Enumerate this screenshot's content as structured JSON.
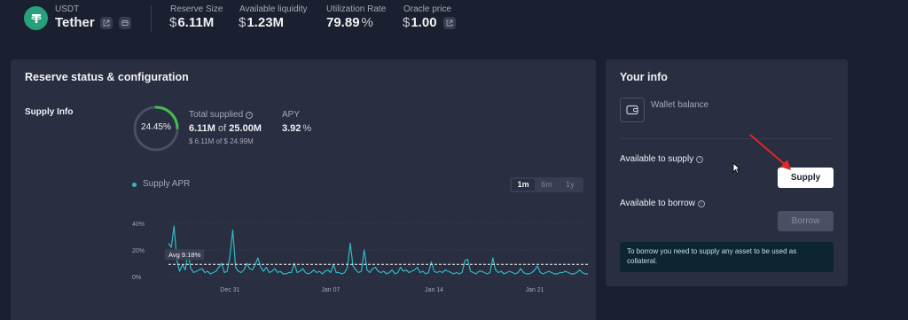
{
  "header": {
    "symbol": "USDT",
    "name": "Tether",
    "logo_icon": "tether-logo-icon",
    "logo_color": "#26a17b",
    "stats": [
      {
        "label": "Reserve Size",
        "currency": "$",
        "value": "6.11M"
      },
      {
        "label": "Available liquidity",
        "currency": "$",
        "value": "1.23M"
      },
      {
        "label": "Utilization Rate",
        "value": "79.89",
        "suffix": "%"
      },
      {
        "label": "Oracle price",
        "currency": "$",
        "value": "1.00"
      }
    ]
  },
  "reserve": {
    "title": "Reserve status & configuration",
    "supply_info_label": "Supply Info",
    "ring_percent_text": "24.45%",
    "ring_fraction": 0.2445,
    "ring_color": "#46bc4b",
    "total_supplied_label": "Total supplied",
    "total_supplied_value": "6.11M",
    "total_supplied_of": "of",
    "total_supplied_cap": "25.00M",
    "total_supplied_usd": "$ 6.11M of $ 24.99M",
    "apy_label": "APY",
    "apy_value": "3.92",
    "apy_suffix": "%",
    "legend": "Supply APR",
    "ranges": [
      {
        "label": "1m",
        "active": true
      },
      {
        "label": "6m",
        "active": false
      },
      {
        "label": "1y",
        "active": false
      }
    ]
  },
  "chart_data": {
    "type": "line",
    "series": [
      {
        "name": "Supply APR",
        "color": "#2ebac6",
        "values": [
          25,
          22,
          38,
          12,
          4,
          9,
          5,
          18,
          6,
          3,
          4,
          5,
          6,
          3,
          4,
          2,
          3,
          4,
          7,
          10,
          3,
          4,
          16,
          35,
          7,
          4,
          3,
          5,
          10,
          6,
          5,
          9,
          14,
          7,
          4,
          7,
          3,
          4,
          6,
          3,
          4,
          2,
          2,
          3,
          3,
          10,
          3,
          4,
          6,
          3,
          2,
          3,
          5,
          3,
          4,
          2,
          4,
          5,
          3,
          9,
          3,
          3,
          2,
          3,
          7,
          25,
          8,
          5,
          3,
          4,
          20,
          5,
          3,
          6,
          7,
          4,
          3,
          4,
          2,
          3,
          5,
          2,
          3,
          7,
          4,
          5,
          3,
          4,
          5,
          7,
          3,
          4,
          2,
          3,
          11,
          4,
          3,
          4,
          3,
          5,
          4,
          3,
          2,
          3,
          2,
          3,
          12,
          13,
          4,
          3,
          2,
          4,
          4,
          3,
          2,
          3,
          14,
          5,
          3,
          4,
          2,
          3,
          4,
          3,
          2,
          3,
          6,
          3,
          2,
          2,
          3,
          5,
          8,
          3,
          2,
          3,
          4,
          3,
          2,
          2,
          3,
          3,
          4,
          3,
          2,
          2,
          3,
          5,
          3,
          2,
          2
        ]
      }
    ],
    "average": 9.18,
    "average_label": "Avg 9.18%",
    "y_ticks": [
      "0%",
      "20%",
      "40%"
    ],
    "ylim": [
      0,
      40
    ],
    "x_ticks": [
      "Dec 31",
      "Jan 07",
      "Jan 14",
      "Jan 21"
    ],
    "x_tick_index": [
      22,
      58,
      95,
      131
    ]
  },
  "your_info": {
    "title": "Your info",
    "wallet_label": "Wallet balance",
    "available_to_supply_label": "Available to supply",
    "supply_button": "Supply",
    "available_to_borrow_label": "Available to borrow",
    "borrow_button": "Borrow",
    "notice": "To borrow you need to supply any asset to be used as collateral."
  }
}
